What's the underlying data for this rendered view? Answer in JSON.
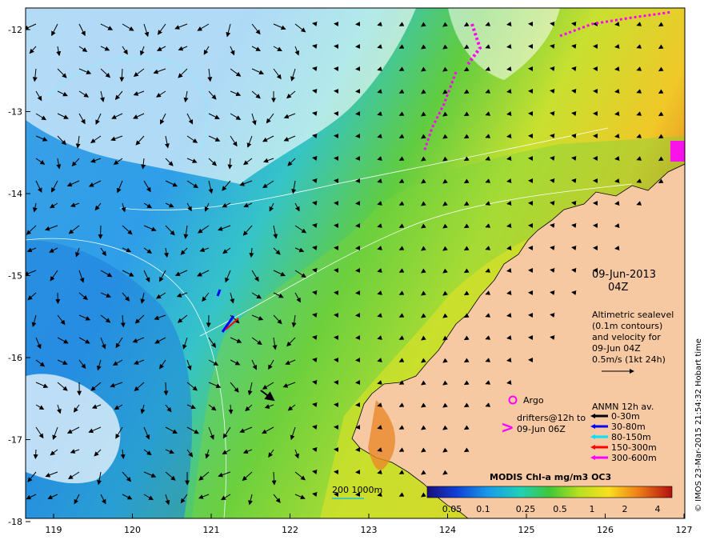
{
  "axes": {
    "lon_ticks": [
      "119",
      "120",
      "121",
      "122",
      "123",
      "124",
      "125",
      "126",
      "127"
    ],
    "lat_ticks": [
      "-12",
      "-13",
      "-14",
      "-15",
      "-16",
      "-17",
      "-18"
    ]
  },
  "panel": {
    "date": "09-Jun-2013",
    "time": "04Z",
    "altimetry_lines": [
      "Altimetric sealevel",
      "(0.1m contours)",
      "and velocity for",
      "09-Jun 04Z",
      "0.5m/s (1kt 24h)"
    ]
  },
  "legend": {
    "argo_label": "Argo",
    "drifter_lines": [
      "drifters@12h to",
      "09-Jun 06Z"
    ],
    "anmn_title": "ANMN 12h av.",
    "anmn_items": [
      {
        "label": "0-30m",
        "color": "#000000"
      },
      {
        "label": "30-80m",
        "color": "#0000ff"
      },
      {
        "label": "80-150m",
        "color": "#00e0ff"
      },
      {
        "label": "150-300m",
        "color": "#ff0000"
      },
      {
        "label": "300-600m",
        "color": "#ff00ff"
      }
    ]
  },
  "colorbar": {
    "title": "MODIS Chl-a mg/m3 OC3",
    "ticks": [
      "0.05",
      "0.1",
      "0.25",
      "0.5",
      "1",
      "2",
      "4"
    ]
  },
  "scale": {
    "label": "200  1000m"
  },
  "credit": "© IMOS 23-Mar-2015 21:54:32 Hobart time",
  "colors": {
    "land": "#f7c9a3",
    "argo": "#ff00ff"
  }
}
